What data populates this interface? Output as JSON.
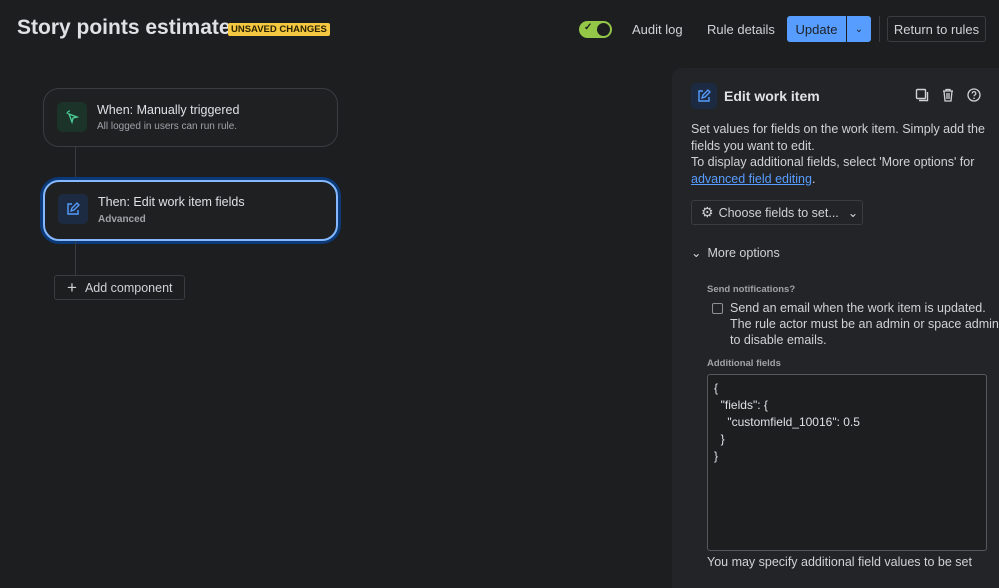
{
  "header": {
    "title": "Story points estimate",
    "badge": "UNSAVED CHANGES",
    "toggle_on": true,
    "audit_log": "Audit log",
    "rule_details": "Rule details",
    "update": "Update",
    "return": "Return to rules"
  },
  "flow": {
    "trigger": {
      "title": "When: Manually triggered",
      "subtitle": "All logged in users can run rule."
    },
    "action": {
      "title": "Then: Edit work item fields",
      "subtitle": "Advanced"
    },
    "add_component": "Add component"
  },
  "panel": {
    "title": "Edit work item",
    "desc1": "Set values for fields on the work item. Simply add the fields you want to edit.",
    "desc2": "To display additional fields, select 'More options' for ",
    "desc_link": "advanced field editing",
    "desc_end": ".",
    "choose_fields": "Choose fields to set...",
    "more_options": "More options",
    "send_notifications_label": "Send notifications?",
    "send_email_text": "Send an email when the work item is updated. The rule actor must be an admin or space admin to disable emails.",
    "send_email_checked": false,
    "additional_fields_label": "Additional fields",
    "additional_fields_value": "{\n  \"fields\": {\n    \"customfield_10016\": 0.5\n  }\n}",
    "footer": "You may specify additional field values to be set"
  }
}
